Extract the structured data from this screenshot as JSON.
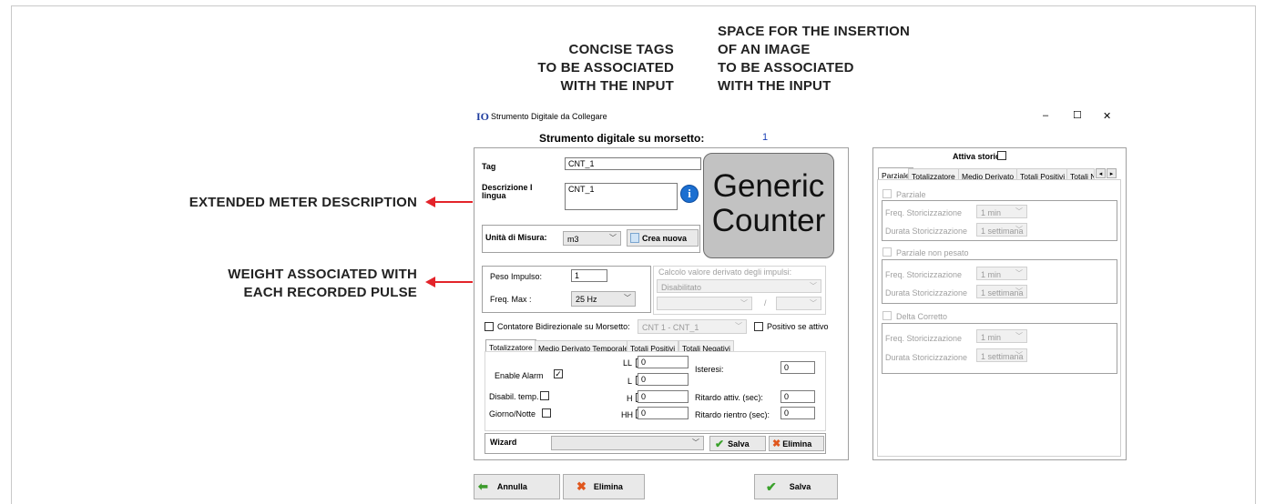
{
  "annotations": {
    "tags": [
      "CONCISE TAGS",
      "TO BE ASSOCIATED",
      "WITH THE INPUT"
    ],
    "image": [
      "SPACE FOR THE INSERTION",
      "OF AN IMAGE",
      "TO BE ASSOCIATED",
      "WITH THE INPUT"
    ],
    "description": [
      "EXTENDED METER DESCRIPTION"
    ],
    "weight": [
      "WEIGHT ASSOCIATED WITH",
      "EACH RECORDED PULSE"
    ]
  },
  "colors": {
    "arrow": "#e3232a",
    "title_value": "#1a3fb5",
    "info": "#1b6fd1"
  },
  "window": {
    "title": "Strumento Digitale da Collegare",
    "app_logo": "IO",
    "controls": {
      "minimize": "–",
      "maximize": "☐",
      "close": "✕"
    },
    "heading": "Strumento digitale su morsetto:",
    "heading_value": "1"
  },
  "form": {
    "tag_label": "Tag",
    "tag_value": "CNT_1",
    "desc_label_1": "Descrizione I",
    "desc_label_2": "lingua",
    "desc_value": "CNT_1",
    "info_icon": "i",
    "image_text_1": "Generic",
    "image_text_2": "Counter",
    "unit_label": "Unità di Misura:",
    "unit_value": "m3",
    "new_unit_label": "Crea nuova",
    "peso_label": "Peso Impulso:",
    "peso_value": "1",
    "freq_label": "Freq. Max :",
    "freq_value": "25 Hz",
    "calc_title": "Calcolo valore derivato degli impulsi:",
    "calc_value": "Disabilitato",
    "calc_sep": "/",
    "bidir_label": "Contatore Bidirezionale su Morsetto:",
    "bidir_value": "CNT 1 - CNT_1",
    "positivo_label": "Positivo se attivo",
    "tabs": [
      "Totalizzatore",
      "Medio Derivato Temporale",
      "Totali Positivi",
      "Totali Negativi"
    ],
    "enable_alarm": "Enable Alarm",
    "disabil_temp": "Disabil. temp.",
    "giorno_notte": "Giorno/Notte",
    "ll_label": "LL",
    "l_label": "L",
    "h_label": "H",
    "hh_label": "HH",
    "ll_value": "0",
    "l_value": "0",
    "h_value": "0",
    "hh_value": "0",
    "isteresi_label": "Isteresi:",
    "isteresi_value": "0",
    "ritardo_attiv_label": "Ritardo attiv. (sec):",
    "ritardo_attiv_value": "0",
    "ritardo_rientro_label": "Ritardo rientro (sec):",
    "ritardo_rientro_value": "0",
    "wizard_label": "Wizard",
    "wizard_value": "",
    "salva_label": "Salva",
    "elimina_label": "Elimina"
  },
  "storici": {
    "title": "Attiva storici",
    "tabs": [
      "Parziale",
      "Totalizzatore",
      "Medio Derivato",
      "Totali Positivi",
      "Totali N"
    ],
    "scroll_left": "◂",
    "scroll_right": "▸",
    "groups": [
      {
        "label": "Parziale",
        "freq_label": "Freq. Storicizzazione",
        "freq_value": "1 min",
        "durata_label": "Durata Storicizzazione",
        "durata_value": "1 settimana"
      },
      {
        "label": "Parziale non pesato",
        "freq_label": "Freq. Storicizzazione",
        "freq_value": "1 min",
        "durata_label": "Durata Storicizzazione",
        "durata_value": "1 settimana"
      },
      {
        "label": "Delta Corretto",
        "freq_label": "Freq. Storicizzazione",
        "freq_value": "1 min",
        "durata_label": "Durata Storicizzazione",
        "durata_value": "1 settimana"
      }
    ]
  },
  "footer": {
    "annulla": "Annulla",
    "elimina": "Elimina",
    "salva": "Salva"
  },
  "icons": {
    "info": "info-icon",
    "arrow_left": "arrow-left-icon",
    "delete": "delete-icon",
    "check": "check-icon",
    "chevron": "chevron-down-icon"
  }
}
